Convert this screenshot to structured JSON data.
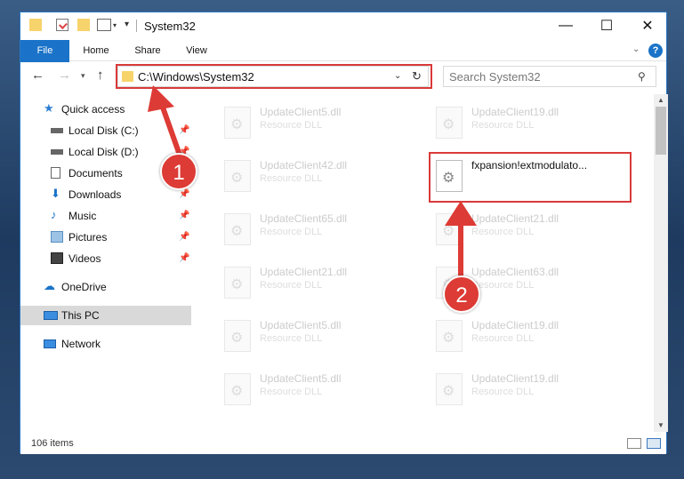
{
  "window": {
    "title": "System32",
    "minimize": "—",
    "maximize": "☐",
    "close": "✕"
  },
  "ribbon": {
    "tabs": [
      "File",
      "Home",
      "Share",
      "View"
    ],
    "help": "?"
  },
  "address": {
    "path": "C:\\Windows\\System32",
    "search_placeholder": "Search System32"
  },
  "sidebar": {
    "items": [
      {
        "label": "Quick access",
        "icon": "star-icon",
        "pinned": false
      },
      {
        "label": "Local Disk (C:)",
        "icon": "drive-icon",
        "pinned": true
      },
      {
        "label": "Local Disk (D:)",
        "icon": "drive-icon",
        "pinned": true
      },
      {
        "label": "Documents",
        "icon": "documents-icon",
        "pinned": true
      },
      {
        "label": "Downloads",
        "icon": "download-icon",
        "pinned": true
      },
      {
        "label": "Music",
        "icon": "music-icon",
        "pinned": true
      },
      {
        "label": "Pictures",
        "icon": "pictures-icon",
        "pinned": true
      },
      {
        "label": "Videos",
        "icon": "videos-icon",
        "pinned": true
      },
      {
        "label": "OneDrive",
        "icon": "cloud-icon",
        "pinned": false
      },
      {
        "label": "This PC",
        "icon": "computer-icon",
        "pinned": false,
        "selected": true
      },
      {
        "label": "Network",
        "icon": "network-icon",
        "pinned": false
      }
    ]
  },
  "files": {
    "left_column": [
      {
        "name": "UpdateClient5.dll",
        "type": "Resource DLL"
      },
      {
        "name": "UpdateClient42.dll",
        "type": "Resource DLL"
      },
      {
        "name": "UpdateClient65.dll",
        "type": "Resource DLL"
      },
      {
        "name": "UpdateClient21.dll",
        "type": "Resource DLL"
      },
      {
        "name": "UpdateClient5.dll",
        "type": "Resource DLL"
      },
      {
        "name": "UpdateClient5.dll",
        "type": "Resource DLL"
      }
    ],
    "right_column": [
      {
        "name": "UpdateClient19.dll",
        "type": "Resource DLL"
      },
      {
        "name": "fxpansion!extmodulato...",
        "type": "",
        "active": true
      },
      {
        "name": "UpdateClient21.dll",
        "type": "Resource DLL"
      },
      {
        "name": "UpdateClient63.dll",
        "type": "Resource DLL"
      },
      {
        "name": "UpdateClient19.dll",
        "type": "Resource DLL"
      },
      {
        "name": "UpdateClient19.dll",
        "type": "Resource DLL"
      }
    ]
  },
  "status": {
    "count": "106 items"
  },
  "annotations": {
    "step1": "1",
    "step2": "2",
    "highlight_color": "#d93a3a"
  }
}
